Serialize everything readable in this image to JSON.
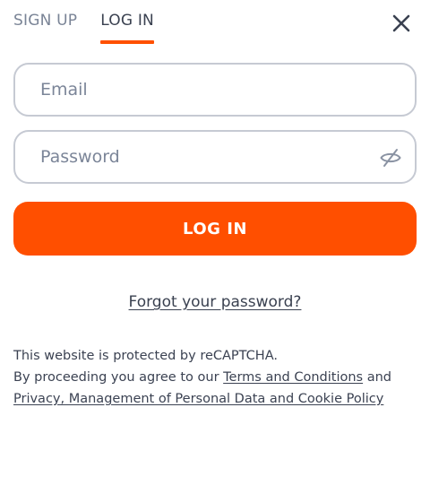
{
  "tabs": [
    {
      "label": "SIGN UP",
      "active": false
    },
    {
      "label": "LOG IN",
      "active": true
    }
  ],
  "close_icon": "close-icon",
  "form": {
    "email_placeholder": "Email",
    "email_value": "",
    "password_placeholder": "Password",
    "password_value": "",
    "password_toggle_icon": "eye-off-icon",
    "submit_label": "LOG IN"
  },
  "forgot_password": "Forgot your password?",
  "legal": {
    "line1": "This website is protected by reCAPTCHA.",
    "line2_prefix": "By proceeding you agree to our ",
    "terms_link": "Terms and Conditions",
    "line2_suffix": " and",
    "privacy_link": "Privacy, Management of Personal Data and Cookie Policy"
  },
  "colors": {
    "accent": "#ff4f00",
    "border": "#c6cad3",
    "text": "#3b4252",
    "muted": "#7a8496"
  }
}
